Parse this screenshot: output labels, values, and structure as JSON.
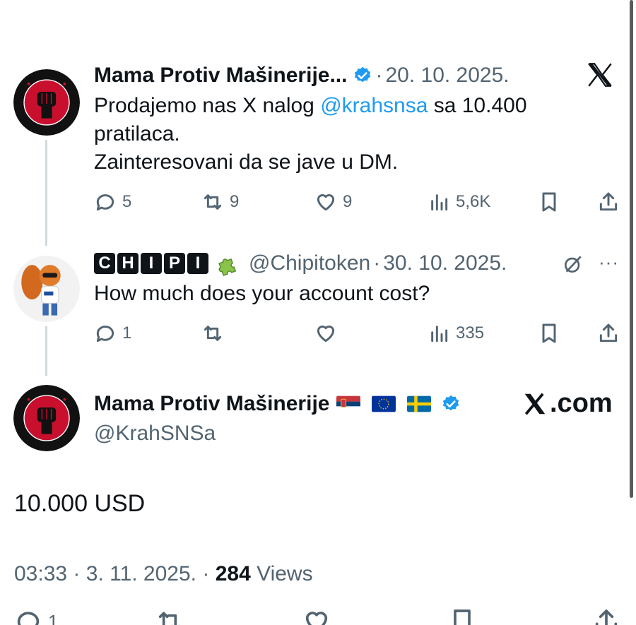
{
  "tweet1": {
    "name": "Mama Protiv Mašinerije...",
    "date": "20. 10. 2025.",
    "text_prefix": "Prodajemo nas X nalog ",
    "mention": "@krahsnsa",
    "text_suffix": " sa 10.400",
    "text_line2": "pratilaca.",
    "text_line3": "Zainteresovani da se jave  u DM.",
    "replies": "5",
    "reposts": "9",
    "likes": "9",
    "views": "5,6K"
  },
  "tweet2": {
    "name_badge": [
      "C",
      "H",
      "I",
      "P",
      "I"
    ],
    "handle": "@Chipitoken",
    "date": "30. 10. 2025.",
    "text": "How much does your account cost?",
    "replies": "1",
    "views": "335"
  },
  "main_tweet": {
    "name": "Mama Protiv Mašinerije",
    "handle": "@KrahSNSa",
    "watermark": ".com",
    "text": "10.000 USD",
    "time": "03:33",
    "date": "3. 11. 2025.",
    "views_count": "284",
    "views_label": "Views",
    "replies": "1"
  },
  "separator": "·",
  "icons": {
    "reply": "reply-icon",
    "repost": "repost-icon",
    "like": "heart-icon",
    "views": "views-icon",
    "bookmark": "bookmark-icon",
    "share": "share-icon",
    "verified": "verified-badge-icon",
    "x_logo": "x-logo-icon"
  },
  "colors": {
    "accent": "#1d9bf0",
    "text": "#0f1419",
    "muted": "#536471",
    "avatar_red": "#c8102e",
    "avatar_black": "#111111"
  }
}
